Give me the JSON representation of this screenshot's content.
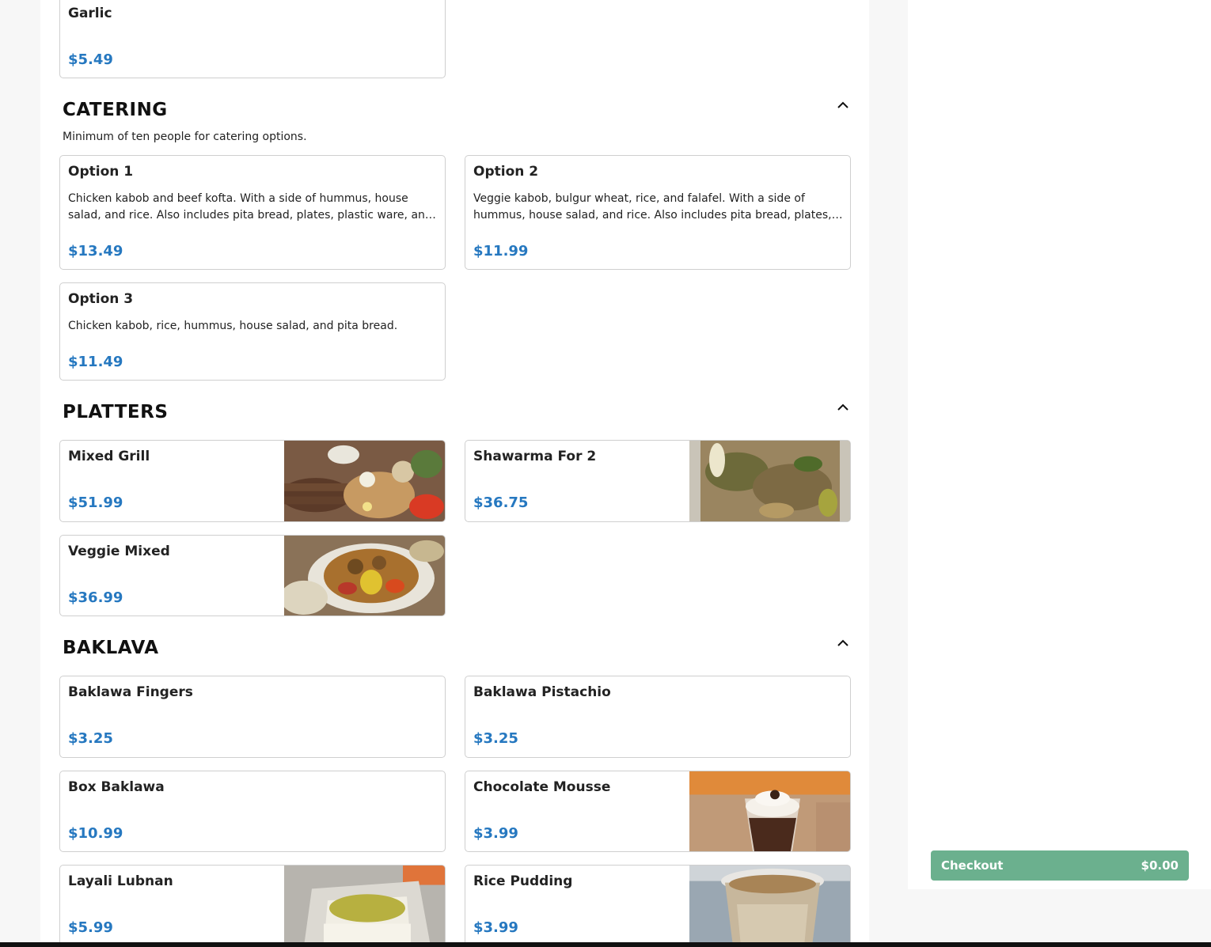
{
  "menu": {
    "top_item": {
      "name": "Garlic",
      "price": "$5.49"
    },
    "sections": {
      "catering": {
        "title": "CATERING",
        "note": "Minimum of ten people for catering options.",
        "items": [
          {
            "name": "Option 1",
            "description": "Chicken kabob and beef kofta. With a side of hummus, house salad, and rice. Also includes pita bread, plates, plastic ware, and napkins.",
            "price": "$13.49"
          },
          {
            "name": "Option 2",
            "description": "Veggie kabob, bulgur wheat, rice, and falafel. With a side of hummus, house salad, and rice. Also includes pita bread, plates, plastic ware, and napkins.",
            "price": "$11.99"
          },
          {
            "name": "Option 3",
            "description": "Chicken kabob, rice, hummus, house salad, and pita bread.",
            "price": "$11.49"
          }
        ]
      },
      "platters": {
        "title": "PLATTERS",
        "items": [
          {
            "name": "Mixed Grill",
            "price": "$51.99"
          },
          {
            "name": "Shawarma For 2",
            "price": "$36.75"
          },
          {
            "name": "Veggie Mixed",
            "price": "$36.99"
          }
        ]
      },
      "baklava": {
        "title": "BAKLAVA",
        "items": [
          {
            "name": "Baklawa Fingers",
            "price": "$3.25"
          },
          {
            "name": "Baklawa Pistachio",
            "price": "$3.25"
          },
          {
            "name": "Box Baklawa",
            "price": "$10.99"
          },
          {
            "name": "Chocolate Mousse",
            "price": "$3.99"
          },
          {
            "name": "Layali Lubnan",
            "price": "$5.99"
          },
          {
            "name": "Rice Pudding",
            "price": "$3.99"
          }
        ]
      }
    }
  },
  "cart": {
    "checkout_label": "Checkout",
    "total": "$0.00"
  },
  "icons": {
    "collapse": "chevron-up-icon"
  },
  "colors": {
    "price": "#2678c0",
    "checkout": "#6bb08e"
  }
}
